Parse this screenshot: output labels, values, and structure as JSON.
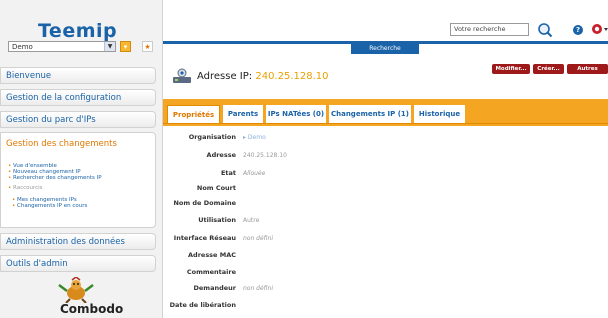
{
  "app": {
    "logo": "Teemip",
    "vendor": "Combodo"
  },
  "header": {
    "org_selected": "Demo",
    "search_placeholder": "Votre recherche",
    "search_button": "Recherche"
  },
  "sidebar": {
    "items": [
      {
        "label": "Bienvenue"
      },
      {
        "label": "Gestion de la configuration"
      },
      {
        "label": "Gestion du parc d'IPs"
      },
      {
        "label": "Gestion des changements"
      },
      {
        "label": "Administration des données"
      },
      {
        "label": "Outils d'admin"
      }
    ],
    "changes_group1": [
      "Vue d'ensemble",
      "Nouveau changement IP",
      "Rechercher des changements IP"
    ],
    "changes_group2_title": "Raccourcis",
    "changes_group3": [
      "Mes changements IPs",
      "Changements IP en cours"
    ]
  },
  "page": {
    "title_prefix": "Adresse IP:",
    "title_ip": "240.25.128.10",
    "actions": [
      "Modifier...",
      "Créer...",
      "Autres Actions"
    ]
  },
  "tabs": [
    "Propriétés",
    "Parents",
    "IPs NATées (0)",
    "Changements IP (1)",
    "Historique"
  ],
  "properties": [
    {
      "label": "Organisation",
      "value": "Demo"
    },
    {
      "label": "Adresse",
      "value": "240.25.128.10"
    },
    {
      "label": "Etat",
      "value": "Allouée"
    },
    {
      "label": "Nom Court",
      "value": ""
    },
    {
      "label": "Nom de Domaine",
      "value": ""
    },
    {
      "label": "Utilisation",
      "value": "Autre"
    },
    {
      "label": "Interface Réseau",
      "value": "non défini"
    },
    {
      "label": "Adresse MAC",
      "value": ""
    },
    {
      "label": "Commentaire",
      "value": ""
    },
    {
      "label": "Demandeur",
      "value": "non défini"
    },
    {
      "label": "Date de libération",
      "value": ""
    }
  ],
  "colors": {
    "brand_blue": "#1a63a8",
    "accent_orange": "#f4a623",
    "action_red": "#9e1a1a",
    "ip_yellow": "#e8a000"
  },
  "icons": [
    "search-icon",
    "help-icon",
    "user-menu-icon",
    "filter-icon",
    "favorite-icon",
    "ip-address-icon",
    "combodo-mascot-icon"
  ]
}
